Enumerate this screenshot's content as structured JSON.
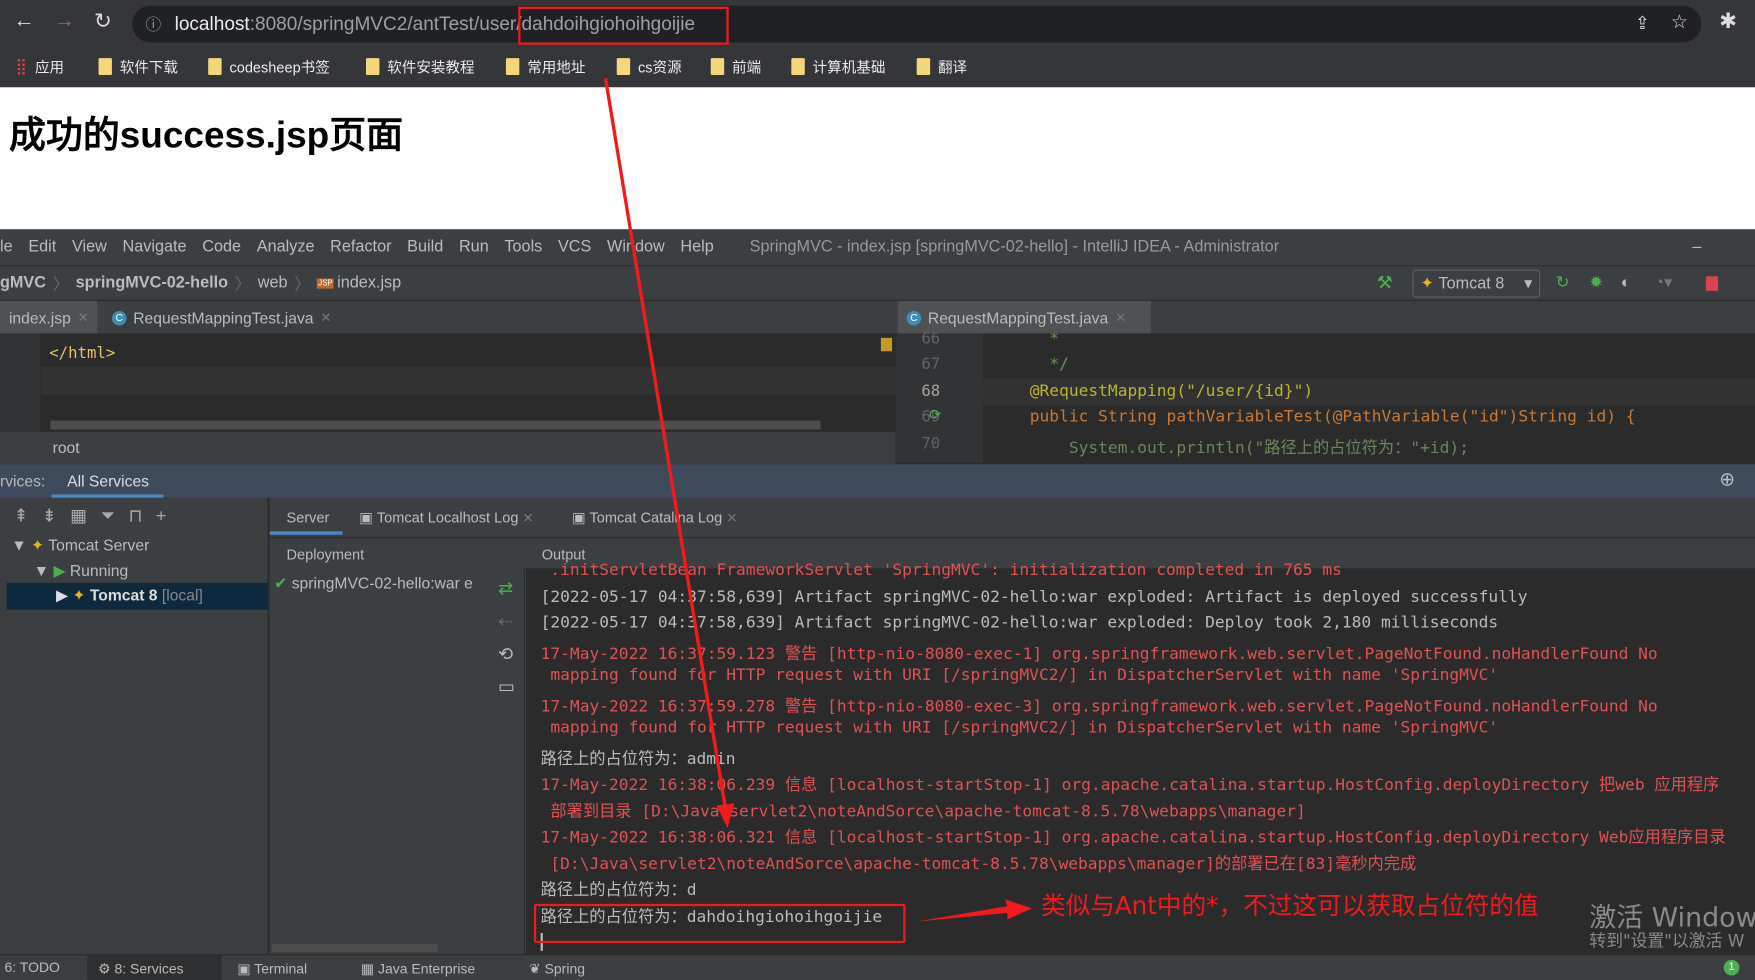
{
  "browser": {
    "url_host": "localhost",
    "url_rest": ":8080/springMVC2/antTest/user/",
    "url_highlight": "dahdoihgiohoihgoijie",
    "bookmarks": [
      "应用",
      "软件下载",
      "codesheep书签",
      "软件安装教程",
      "常用地址",
      "cs资源",
      "前端",
      "计算机基础",
      "翻译"
    ]
  },
  "page": {
    "heading": "成功的success.jsp页面"
  },
  "ide": {
    "menu": [
      "le",
      "Edit",
      "View",
      "Navigate",
      "Code",
      "Analyze",
      "Refactor",
      "Build",
      "Run",
      "Tools",
      "VCS",
      "Window",
      "Help"
    ],
    "title": "SpringMVC - index.jsp [springMVC-02-hello] - IntelliJ IDEA - Administrator",
    "breadcrumb": [
      "gMVC",
      "springMVC-02-hello",
      "web",
      "index.jsp"
    ],
    "run_config": "Tomcat 8",
    "tabs_left": [
      "index.jsp",
      "RequestMappingTest.java"
    ],
    "tab_right": "RequestMappingTest.java",
    "left_code": "</html>",
    "left_crumb": "root",
    "right_lines": [
      {
        "n": "66",
        "code": "  *"
      },
      {
        "n": "67",
        "code": "  */"
      },
      {
        "n": "68",
        "code": "@RequestMapping(\"/user/{id}\")"
      },
      {
        "n": "69",
        "code": "public String pathVariableTest(@PathVariable(\"id\")String id) {"
      },
      {
        "n": "70",
        "code": "    System.out.println(\"路径上的占位符为：\"+id);"
      }
    ]
  },
  "services": {
    "label": "rvices:",
    "tab": "All Services",
    "tree": [
      "Tomcat Server",
      "Running",
      "Tomcat 8",
      "[local]"
    ],
    "subtabs": [
      "Server",
      "Tomcat Localhost Log",
      "Tomcat Catalina Log"
    ],
    "col_deployment": "Deployment",
    "col_output": "Output",
    "deployment": "springMVC-02-hello:war e",
    "output": [
      {
        "c": "r",
        "t": " .initServletBean FrameworkServlet 'SpringMVC': initialization completed in 765 ms"
      },
      {
        "c": "g",
        "t": "[2022-05-17 04:37:58,639] Artifact springMVC-02-hello:war exploded: Artifact is deployed successfully"
      },
      {
        "c": "g",
        "t": "[2022-05-17 04:37:58,639] Artifact springMVC-02-hello:war exploded: Deploy took 2,180 milliseconds"
      },
      {
        "c": "r",
        "t": "17-May-2022 16:37:59.123 警告 [http-nio-8080-exec-1] org.springframework.web.servlet.PageNotFound.noHandlerFound No"
      },
      {
        "c": "r",
        "t": " mapping found for HTTP request with URI [/springMVC2/] in DispatcherServlet with name 'SpringMVC'"
      },
      {
        "c": "r",
        "t": "17-May-2022 16:37:59.278 警告 [http-nio-8080-exec-3] org.springframework.web.servlet.PageNotFound.noHandlerFound No"
      },
      {
        "c": "r",
        "t": " mapping found for HTTP request with URI [/springMVC2/] in DispatcherServlet with name 'SpringMVC'"
      },
      {
        "c": "g",
        "t": "路径上的占位符为：admin"
      },
      {
        "c": "r",
        "t": "17-May-2022 16:38:06.239 信息 [localhost-startStop-1] org.apache.catalina.startup.HostConfig.deployDirectory 把web 应用程序"
      },
      {
        "c": "r",
        "t": " 部署到目录 [D:\\Java\\servlet2\\noteAndSorce\\apache-tomcat-8.5.78\\webapps\\manager]"
      },
      {
        "c": "r",
        "t": "17-May-2022 16:38:06.321 信息 [localhost-startStop-1] org.apache.catalina.startup.HostConfig.deployDirectory Web应用程序目录"
      },
      {
        "c": "r",
        "t": " [D:\\Java\\servlet2\\noteAndSorce\\apache-tomcat-8.5.78\\webapps\\manager]的部署已在[83]毫秒内完成"
      },
      {
        "c": "g",
        "t": "路径上的占位符为：d"
      },
      {
        "c": "g",
        "t": "路径上的占位符为：dahdoihgiohoihgoijie"
      }
    ]
  },
  "annotation": "类似与Ant中的*，不过这可以获取占位符的值",
  "watermark": {
    "line1": "激活 Windows",
    "line2": "转到\"设置\"以激活 W"
  },
  "statusbar": [
    "6: TODO",
    "8: Services",
    "Terminal",
    "Java Enterprise",
    "Spring"
  ],
  "colors": {
    "annotation": "#f21b1b",
    "error_text": "#e05252",
    "accent": "#4a88c7"
  }
}
